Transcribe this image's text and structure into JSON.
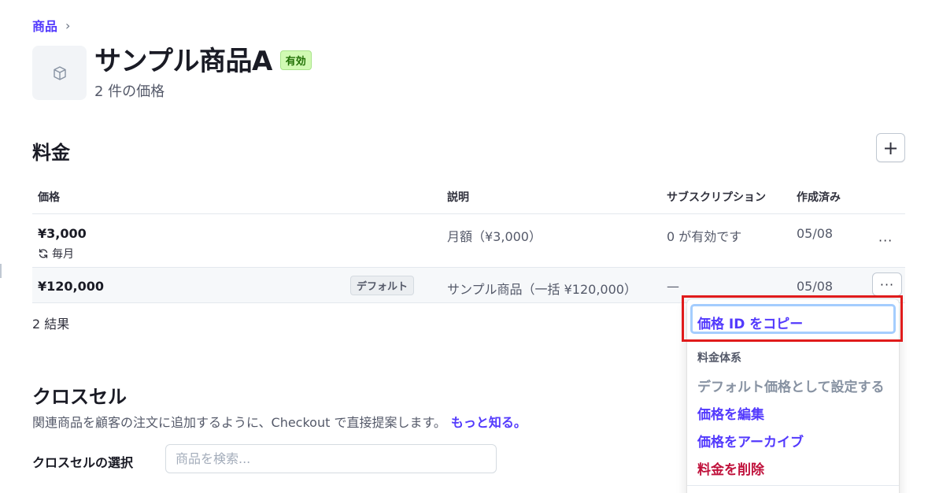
{
  "breadcrumb": {
    "label": "商品",
    "separator": "›"
  },
  "product": {
    "title": "サンプル商品A",
    "status": "有効",
    "price_count": "2 件の価格"
  },
  "pricing": {
    "title": "料金",
    "add_icon": "plus-icon",
    "columns": [
      "価格",
      "説明",
      "サブスクリプション",
      "作成済み"
    ],
    "rows": [
      {
        "price": "¥3,000",
        "interval": "毎月",
        "description": "月額（¥3,000）",
        "subscriptions": "0 が有効です",
        "created": "05/08"
      },
      {
        "price": "¥120,000",
        "badge": "デフォルト",
        "description": "サンプル商品（一括 ¥120,000）",
        "subscriptions": "—",
        "created": "05/08"
      }
    ],
    "more_label": "···",
    "results": "2 結果"
  },
  "crosssell": {
    "title": "クロスセル",
    "description": "関連商品を顧客の注文に追加するように、Checkout で直接提案します。",
    "learn_more": "もっと知る。",
    "select_label": "クロスセルの選択",
    "search_placeholder": "商品を検索..."
  },
  "menu": {
    "copy_id": "価格 ID をコピー",
    "section_head": "料金体系",
    "set_default": "デフォルト価格として設定する",
    "edit": "価格を編集",
    "archive": "価格をアーカイブ",
    "delete": "料金を削除"
  },
  "colors": {
    "accent": "#533afd",
    "danger": "#c0123c",
    "active_badge_bg": "#d1fab3",
    "highlight": "#e01b1b"
  }
}
